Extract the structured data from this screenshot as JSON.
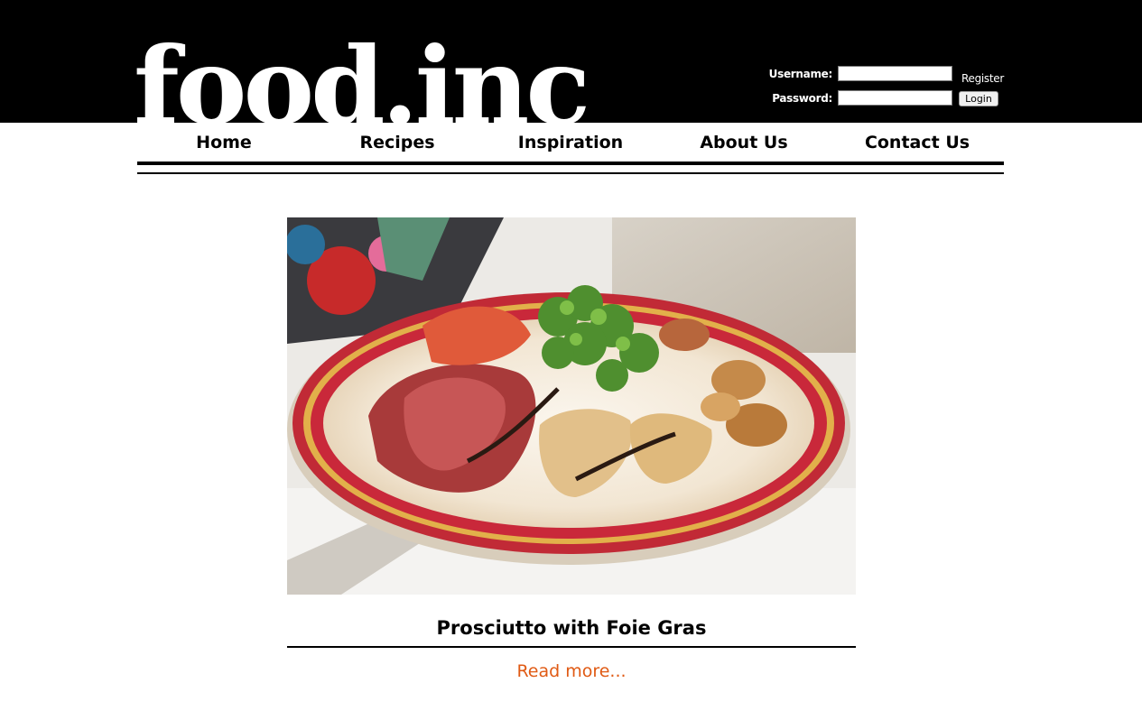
{
  "header": {
    "logo": "food.inc",
    "background_color": "#000000"
  },
  "login": {
    "username_label": "Username:",
    "username_value": "",
    "password_label": "Password:",
    "password_value": "",
    "register_label": "Register",
    "login_label": "Login"
  },
  "nav": {
    "items": [
      {
        "label": "Home"
      },
      {
        "label": "Recipes"
      },
      {
        "label": "Inspiration"
      },
      {
        "label": "About Us"
      },
      {
        "label": "Contact Us"
      }
    ]
  },
  "featured": {
    "title": "Prosciutto with Foie Gras",
    "read_more": "Read more...",
    "link_color": "#e05a14"
  }
}
